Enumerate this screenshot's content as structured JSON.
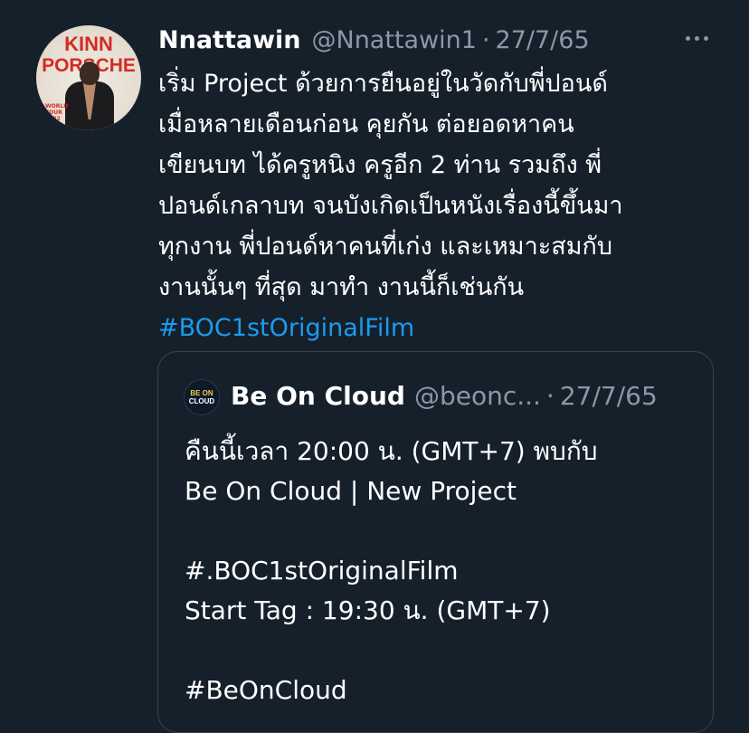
{
  "tweet": {
    "display_name": "Nnattawin",
    "handle": "@Nnattawin1",
    "separator": "·",
    "date": "27/7/65",
    "avatar": {
      "line1": "KINN",
      "line2": "PORSCHE",
      "small_text": "WORLD TOUR 2022"
    },
    "text_lines": [
      "เริ่ม Project ด้วยการยืนอยู่ในวัดกับพี่ปอนด์",
      "เมื่อหลายเดือนก่อน คุยกัน ต่อยอดหาคน",
      "เขียนบท ได้ครูหนิง ครูอีก 2 ท่าน รวมถึง พี่",
      "ปอนด์เกลาบท จนบังเกิดเป็นหนังเรื่องนี้ขึ้นมา",
      "ทุกงาน พี่ปอนด์หาคนที่เก่ง และเหมาะสมกับ",
      "งานนั้นๆ ที่สุด มาทำ งานนี้ก็เช่นกัน"
    ],
    "hashtag": "#BOC1stOriginalFilm"
  },
  "quoted": {
    "display_name": "Be On Cloud",
    "handle": "@beonc...",
    "separator": "·",
    "date": "27/7/65",
    "avatar": {
      "line1": "BE ON",
      "line2": "CLOUD"
    },
    "text_lines": [
      "คืนนี้เวลา 20:00 น. (GMT+7) พบกับ",
      "Be On Cloud | New Project",
      "",
      "#.BOC1stOriginalFilm",
      "Start Tag : 19:30 น. (GMT+7)",
      "",
      "#BeOnCloud"
    ]
  },
  "colors": {
    "background": "#15202b",
    "text": "#ffffff",
    "secondary": "#8b98a5",
    "link": "#1d9bf0",
    "border": "#38444d"
  },
  "icons": {
    "more": "more-horizontal-icon"
  }
}
